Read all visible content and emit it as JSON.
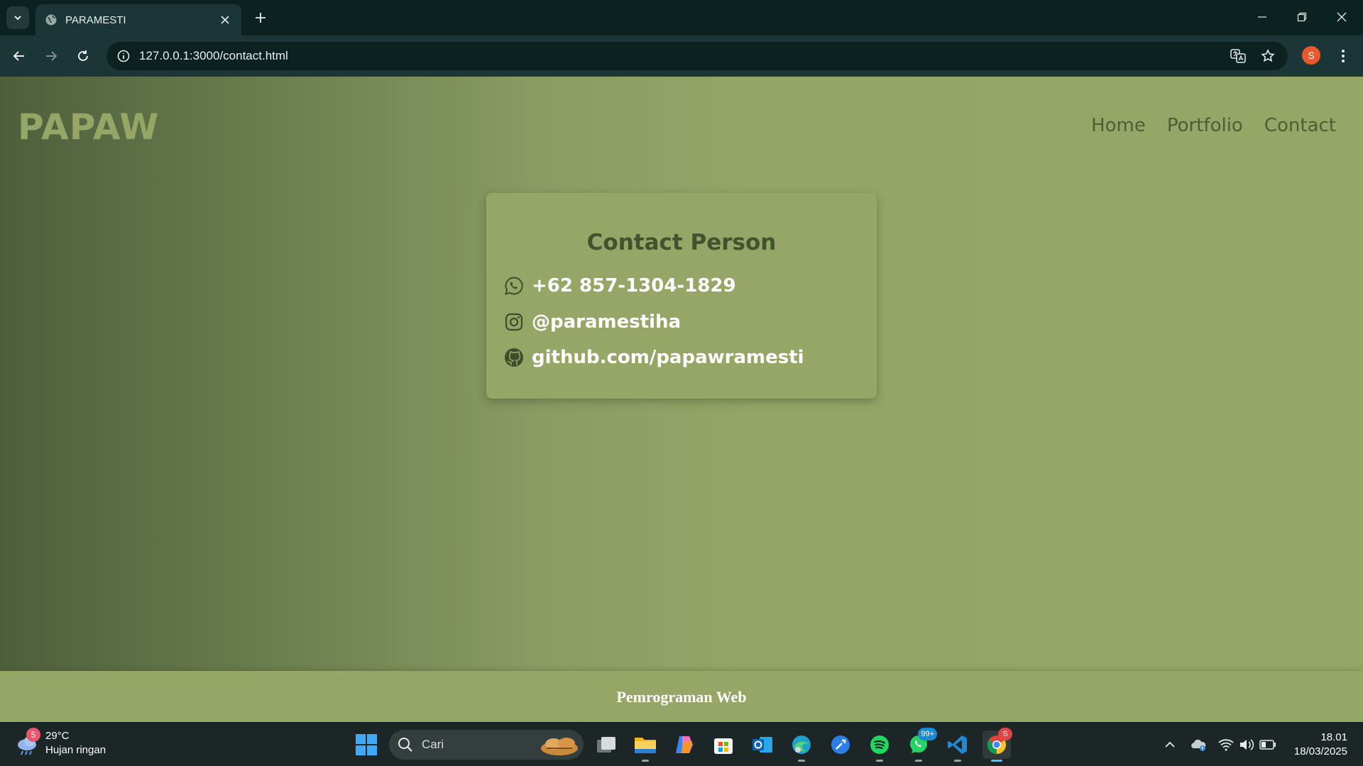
{
  "browser": {
    "tab_title": "PARAMESTI",
    "url": "127.0.0.1:3000/contact.html",
    "profile_initial": "S"
  },
  "site": {
    "brand": "PAPAW",
    "nav": [
      "Home",
      "Portfolio",
      "Contact"
    ],
    "card_title": "Contact Person",
    "contacts": [
      {
        "icon": "whatsapp-icon",
        "text": "+62 857-1304-1829"
      },
      {
        "icon": "instagram-icon",
        "text": "@paramestiha"
      },
      {
        "icon": "github-icon",
        "text": "github.com/papawramesti"
      }
    ],
    "footer": "Pemrograman Web"
  },
  "taskbar": {
    "weather_temp": "29°C",
    "weather_desc": "Hujan ringan",
    "weather_badge": "5",
    "search_placeholder": "Cari",
    "whatsapp_badge": "99+",
    "chrome_badge": "S",
    "time": "18.01",
    "date": "18/03/2025"
  },
  "colors": {
    "page_accent": "#96a667",
    "nav_text": "#4d5e36",
    "chrome_bg": "#0b2220"
  }
}
